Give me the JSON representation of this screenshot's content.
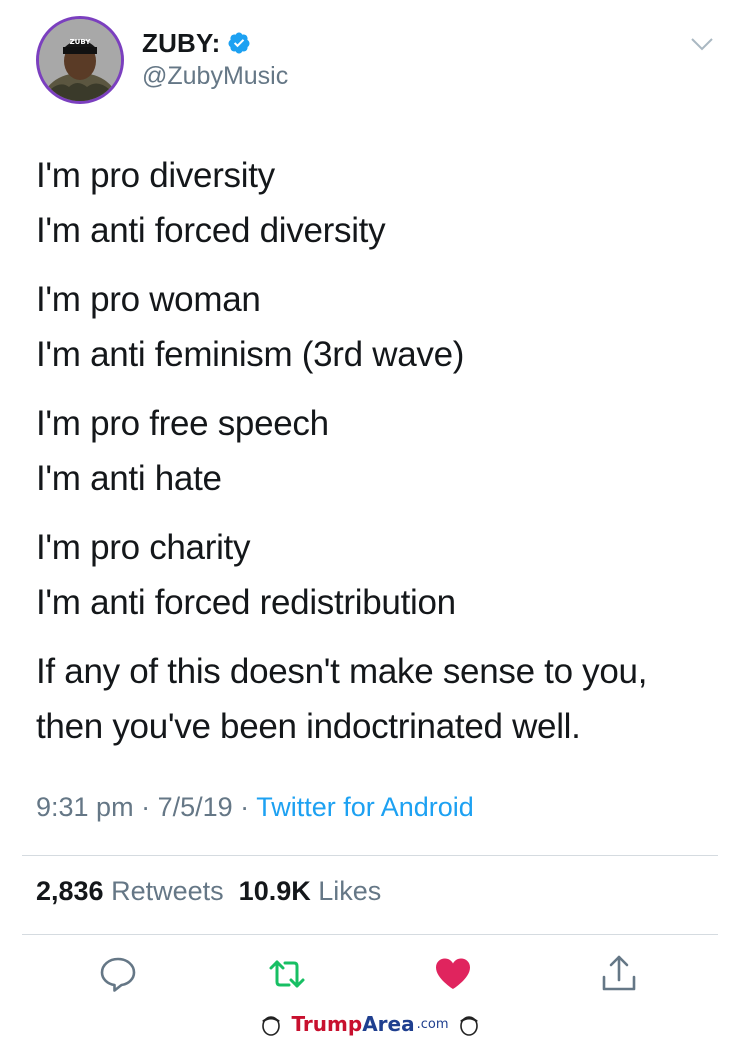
{
  "tweet": {
    "display_name": "ZUBY:",
    "handle": "@ZubyMusic",
    "verified": true,
    "avatar_cap_text": "ZUBY",
    "paragraphs": [
      [
        "I'm pro diversity",
        "I'm anti forced diversity"
      ],
      [
        "I'm pro woman",
        "I'm anti feminism (3rd wave)"
      ],
      [
        "I'm pro free speech",
        "I'm anti hate"
      ],
      [
        "I'm pro charity",
        "I'm anti forced redistribution"
      ],
      [
        "If any of this doesn't make sense to you,",
        "then you've been indoctrinated well."
      ]
    ],
    "time": "9:31 pm",
    "date": "7/5/19",
    "source": "Twitter for Android",
    "retweets_count": "2,836",
    "retweets_label": "Retweets",
    "likes_count": "10.9K",
    "likes_label": "Likes"
  },
  "icons": {
    "verified": "verified-badge-icon",
    "more": "chevron-down-icon",
    "reply": "reply-icon",
    "retweet": "retweet-icon",
    "like": "heart-icon",
    "share": "share-icon"
  },
  "colors": {
    "accent": "#1da1f2",
    "retweet": "#17bf63",
    "like": "#e0245e",
    "secondary_text": "#657786"
  },
  "watermark": {
    "part1": "Trump",
    "part2": "Area",
    "part3": ".com"
  }
}
